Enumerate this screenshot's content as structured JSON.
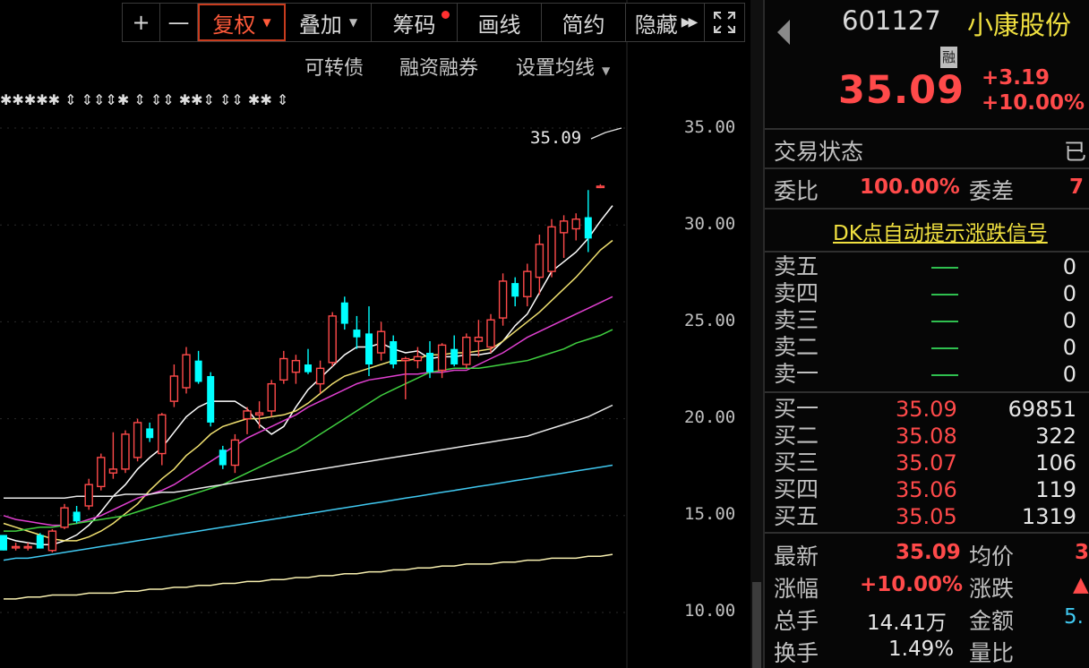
{
  "toolbar": {
    "plus": "+",
    "minus": "—",
    "fuquan": "复权",
    "diejia": "叠加",
    "chouma": "筹码",
    "huaxian": "画线",
    "jianyue": "简约",
    "yincang": "隐藏"
  },
  "subbar": {
    "kezhuanzhai": "可转债",
    "rongzi": "融资融券",
    "shezhi": "设置均线"
  },
  "chart_data": {
    "type": "candlestick",
    "y_axis_labels": [
      "35.00",
      "30.00",
      "25.00",
      "20.00",
      "15.00",
      "10.00"
    ],
    "ylim": [
      10,
      35
    ],
    "last_price_tag": "35.09",
    "marker_rows": "✱✱✱✱✱ ⇕ ⇕⇕⇕✱ ⇕ ⇕⇕ ✱✱⇕ ⇕⇕ ✱✱ ⇕",
    "candles": [
      {
        "o": 14.0,
        "h": 14.0,
        "l": 13.2,
        "c": 13.2
      },
      {
        "o": 13.4,
        "h": 13.6,
        "l": 13.2,
        "c": 13.4
      },
      {
        "o": 13.4,
        "h": 13.6,
        "l": 13.2,
        "c": 13.4
      },
      {
        "o": 14.0,
        "h": 14.1,
        "l": 13.3,
        "c": 13.3
      },
      {
        "o": 13.2,
        "h": 14.3,
        "l": 13.1,
        "c": 14.2
      },
      {
        "o": 14.4,
        "h": 15.6,
        "l": 14.3,
        "c": 15.4
      },
      {
        "o": 15.2,
        "h": 15.5,
        "l": 14.6,
        "c": 14.7
      },
      {
        "o": 15.5,
        "h": 16.9,
        "l": 15.3,
        "c": 16.6
      },
      {
        "o": 16.5,
        "h": 18.2,
        "l": 16.3,
        "c": 18.0
      },
      {
        "o": 17.2,
        "h": 19.3,
        "l": 16.9,
        "c": 17.4
      },
      {
        "o": 17.4,
        "h": 19.4,
        "l": 17.2,
        "c": 19.2
      },
      {
        "o": 18.0,
        "h": 20.0,
        "l": 17.8,
        "c": 19.8
      },
      {
        "o": 19.5,
        "h": 19.8,
        "l": 18.8,
        "c": 19.0
      },
      {
        "o": 18.2,
        "h": 20.3,
        "l": 17.6,
        "c": 20.2
      },
      {
        "o": 20.9,
        "h": 22.8,
        "l": 20.6,
        "c": 22.2
      },
      {
        "o": 21.6,
        "h": 23.7,
        "l": 21.3,
        "c": 23.3
      },
      {
        "o": 23.0,
        "h": 23.5,
        "l": 21.8,
        "c": 21.9
      },
      {
        "o": 22.2,
        "h": 22.4,
        "l": 19.6,
        "c": 19.8
      },
      {
        "o": 18.4,
        "h": 18.6,
        "l": 17.4,
        "c": 17.6
      },
      {
        "o": 17.6,
        "h": 19.2,
        "l": 17.2,
        "c": 18.9
      },
      {
        "o": 20.0,
        "h": 20.6,
        "l": 19.2,
        "c": 20.4
      },
      {
        "o": 20.2,
        "h": 20.9,
        "l": 19.5,
        "c": 20.3
      },
      {
        "o": 20.4,
        "h": 22.0,
        "l": 20.1,
        "c": 21.8
      },
      {
        "o": 22.0,
        "h": 23.5,
        "l": 21.8,
        "c": 23.1
      },
      {
        "o": 22.4,
        "h": 23.3,
        "l": 21.8,
        "c": 23.0
      },
      {
        "o": 22.8,
        "h": 23.6,
        "l": 22.3,
        "c": 22.4
      },
      {
        "o": 21.8,
        "h": 23.0,
        "l": 21.3,
        "c": 22.6
      },
      {
        "o": 22.9,
        "h": 25.5,
        "l": 22.7,
        "c": 25.3
      },
      {
        "o": 26.0,
        "h": 26.3,
        "l": 24.6,
        "c": 24.9
      },
      {
        "o": 24.6,
        "h": 25.3,
        "l": 23.6,
        "c": 24.2
      },
      {
        "o": 24.4,
        "h": 25.8,
        "l": 22.2,
        "c": 22.8
      },
      {
        "o": 23.4,
        "h": 25.0,
        "l": 23.0,
        "c": 24.5
      },
      {
        "o": 24.0,
        "h": 24.3,
        "l": 22.6,
        "c": 22.8
      },
      {
        "o": 23.0,
        "h": 23.2,
        "l": 21.0,
        "c": 23.1
      },
      {
        "o": 23.0,
        "h": 23.7,
        "l": 22.6,
        "c": 23.2
      },
      {
        "o": 23.4,
        "h": 24.0,
        "l": 22.1,
        "c": 22.4
      },
      {
        "o": 22.5,
        "h": 23.9,
        "l": 22.1,
        "c": 23.8
      },
      {
        "o": 23.6,
        "h": 24.3,
        "l": 22.7,
        "c": 22.8
      },
      {
        "o": 22.8,
        "h": 24.4,
        "l": 22.6,
        "c": 24.2
      },
      {
        "o": 24.0,
        "h": 25.1,
        "l": 23.2,
        "c": 24.2
      },
      {
        "o": 23.7,
        "h": 25.4,
        "l": 23.4,
        "c": 25.1
      },
      {
        "o": 25.2,
        "h": 27.5,
        "l": 24.8,
        "c": 27.1
      },
      {
        "o": 27.0,
        "h": 27.3,
        "l": 25.8,
        "c": 26.3
      },
      {
        "o": 26.3,
        "h": 28.0,
        "l": 25.8,
        "c": 27.6
      },
      {
        "o": 27.3,
        "h": 29.5,
        "l": 26.4,
        "c": 29.0
      },
      {
        "o": 27.6,
        "h": 30.3,
        "l": 27.3,
        "c": 29.9
      },
      {
        "o": 29.6,
        "h": 30.5,
        "l": 28.3,
        "c": 30.2
      },
      {
        "o": 29.8,
        "h": 30.6,
        "l": 29.2,
        "c": 30.3
      },
      {
        "o": 30.4,
        "h": 31.8,
        "l": 28.6,
        "c": 29.3
      },
      {
        "o": 32.0,
        "h": 32.1,
        "l": 31.9,
        "c": 32.0
      }
    ],
    "ma_lines": [
      {
        "color": "#ffffff",
        "values": [
          13.9,
          13.7,
          13.6,
          13.5,
          13.5,
          13.7,
          14.0,
          14.5,
          15.2,
          16.0,
          16.6,
          17.4,
          18.0,
          18.5,
          19.3,
          20.1,
          20.6,
          20.9,
          20.9,
          20.9,
          20.5,
          19.7,
          19.2,
          19.6,
          20.6,
          21.5,
          22.1,
          22.7,
          23.3,
          23.7,
          23.7,
          23.9,
          23.6,
          23.4,
          23.5,
          23.1,
          23.2,
          23.2,
          23.3,
          23.3,
          23.4,
          24.0,
          24.8,
          25.4,
          26.5,
          27.6,
          28.1,
          28.6,
          29.3,
          30.2,
          31.0
        ]
      },
      {
        "color": "#f0e070",
        "values": [
          14.6,
          14.4,
          14.2,
          14.0,
          13.8,
          13.7,
          13.7,
          13.9,
          14.2,
          14.6,
          15.1,
          15.6,
          16.3,
          16.9,
          17.4,
          18.1,
          18.6,
          19.2,
          19.6,
          19.8,
          20.0,
          20.0,
          20.1,
          20.2,
          20.4,
          20.8,
          21.3,
          21.8,
          22.2,
          22.4,
          22.6,
          22.8,
          23.0,
          23.0,
          23.1,
          23.3,
          23.3,
          23.4,
          23.4,
          23.5,
          23.6,
          24.0,
          24.5,
          25.0,
          25.5,
          26.1,
          26.7,
          27.3,
          28.0,
          28.7,
          29.2
        ]
      },
      {
        "color": "#e040d0",
        "values": [
          15.0,
          14.8,
          14.7,
          14.6,
          14.5,
          14.5,
          14.6,
          14.8,
          15.0,
          15.3,
          15.6,
          15.9,
          16.1,
          16.3,
          16.6,
          17.0,
          17.4,
          17.8,
          18.2,
          18.6,
          19.0,
          19.3,
          19.6,
          19.9,
          20.2,
          20.6,
          20.9,
          21.2,
          21.5,
          21.8,
          22.0,
          22.1,
          22.2,
          22.3,
          22.3,
          22.4,
          22.4,
          22.5,
          22.5,
          22.8,
          23.1,
          23.4,
          23.8,
          24.2,
          24.5,
          24.8,
          25.1,
          25.4,
          25.7,
          26.0,
          26.3
        ]
      },
      {
        "color": "#40d040",
        "values": [
          14.2,
          14.2,
          14.3,
          14.4,
          14.4,
          14.5,
          14.6,
          14.7,
          14.8,
          14.9,
          15.0,
          15.2,
          15.4,
          15.6,
          15.8,
          16.0,
          16.2,
          16.4,
          16.6,
          16.9,
          17.2,
          17.5,
          17.8,
          18.1,
          18.4,
          18.8,
          19.2,
          19.6,
          20.0,
          20.4,
          20.8,
          21.2,
          21.5,
          21.8,
          22.1,
          22.4,
          22.5,
          22.6,
          22.6,
          22.6,
          22.7,
          22.8,
          22.9,
          23.0,
          23.2,
          23.4,
          23.6,
          23.9,
          24.1,
          24.3,
          24.6
        ]
      },
      {
        "color": "#e8e8e8",
        "values": [
          15.9,
          15.9,
          15.9,
          15.9,
          15.9,
          15.9,
          16.0,
          16.0,
          16.0,
          16.0,
          16.1,
          16.1,
          16.1,
          16.2,
          16.2,
          16.3,
          16.4,
          16.5,
          16.6,
          16.7,
          16.8,
          16.9,
          17.0,
          17.1,
          17.2,
          17.3,
          17.4,
          17.5,
          17.6,
          17.7,
          17.8,
          17.9,
          18.0,
          18.1,
          18.2,
          18.3,
          18.4,
          18.5,
          18.6,
          18.7,
          18.8,
          18.9,
          19.0,
          19.1,
          19.3,
          19.5,
          19.7,
          19.9,
          20.1,
          20.4,
          20.7
        ]
      },
      {
        "color": "#40c8f0",
        "values": [
          12.7,
          12.8,
          12.8,
          12.9,
          13.0,
          13.1,
          13.2,
          13.3,
          13.4,
          13.5,
          13.6,
          13.7,
          13.8,
          13.9,
          14.0,
          14.1,
          14.2,
          14.3,
          14.4,
          14.5,
          14.6,
          14.7,
          14.8,
          14.9,
          15.0,
          15.1,
          15.2,
          15.3,
          15.4,
          15.5,
          15.6,
          15.7,
          15.8,
          15.9,
          16.0,
          16.1,
          16.2,
          16.3,
          16.4,
          16.5,
          16.6,
          16.7,
          16.8,
          16.9,
          17.0,
          17.1,
          17.2,
          17.3,
          17.4,
          17.5,
          17.6
        ]
      },
      {
        "color": "#f8f0b0",
        "values": [
          10.7,
          10.7,
          10.8,
          10.8,
          10.9,
          10.9,
          10.9,
          11.0,
          11.0,
          11.0,
          11.1,
          11.1,
          11.2,
          11.2,
          11.3,
          11.3,
          11.4,
          11.4,
          11.5,
          11.5,
          11.6,
          11.6,
          11.7,
          11.7,
          11.8,
          11.8,
          11.9,
          11.9,
          12.0,
          12.0,
          12.1,
          12.1,
          12.2,
          12.2,
          12.3,
          12.3,
          12.4,
          12.4,
          12.5,
          12.5,
          12.5,
          12.6,
          12.6,
          12.7,
          12.7,
          12.8,
          12.8,
          12.8,
          12.9,
          12.9,
          13.0
        ]
      }
    ],
    "colors": {
      "up": "#ff4a4a",
      "down": "#00ffff",
      "grid": "#2a2a2a"
    }
  },
  "panel": {
    "code": "601127",
    "name": "小康股份",
    "rong_badge": "融",
    "price": "35.09",
    "change": "+3.19",
    "change_pct": "+10.00%",
    "trade_status_label": "交易状态",
    "trade_status_value": "已",
    "weibi_label": "委比",
    "weibi_value": "100.00%",
    "weicha_label": "委差",
    "weicha_value": "7",
    "dk_link": "DK点自动提示涨跌信号",
    "asks": [
      {
        "label": "卖五",
        "vol": "0"
      },
      {
        "label": "卖四",
        "vol": "0"
      },
      {
        "label": "卖三",
        "vol": "0"
      },
      {
        "label": "卖二",
        "vol": "0"
      },
      {
        "label": "卖一",
        "vol": "0"
      }
    ],
    "bids": [
      {
        "label": "买一",
        "price": "35.09",
        "vol": "69851"
      },
      {
        "label": "买二",
        "price": "35.08",
        "vol": "322"
      },
      {
        "label": "买三",
        "price": "35.07",
        "vol": "106"
      },
      {
        "label": "买四",
        "price": "35.06",
        "vol": "119"
      },
      {
        "label": "买五",
        "price": "35.05",
        "vol": "1319"
      }
    ],
    "stats": {
      "zuixin_label": "最新",
      "zuixin_value": "35.09",
      "junjia_label": "均价",
      "junjia_value": "3",
      "zhangfu_label": "涨幅",
      "zhangfu_value": "+10.00%",
      "zhangdie_label": "涨跌",
      "zhangdie_value": "▲",
      "zongshou_label": "总手",
      "zongshou_value": "14.41万",
      "jine_label": "金额",
      "jine_value": "5.",
      "huanshou_label": "换手",
      "huanshou_value": "1.49%",
      "liangbi_label": "量比",
      "liangbi_value": ""
    }
  }
}
